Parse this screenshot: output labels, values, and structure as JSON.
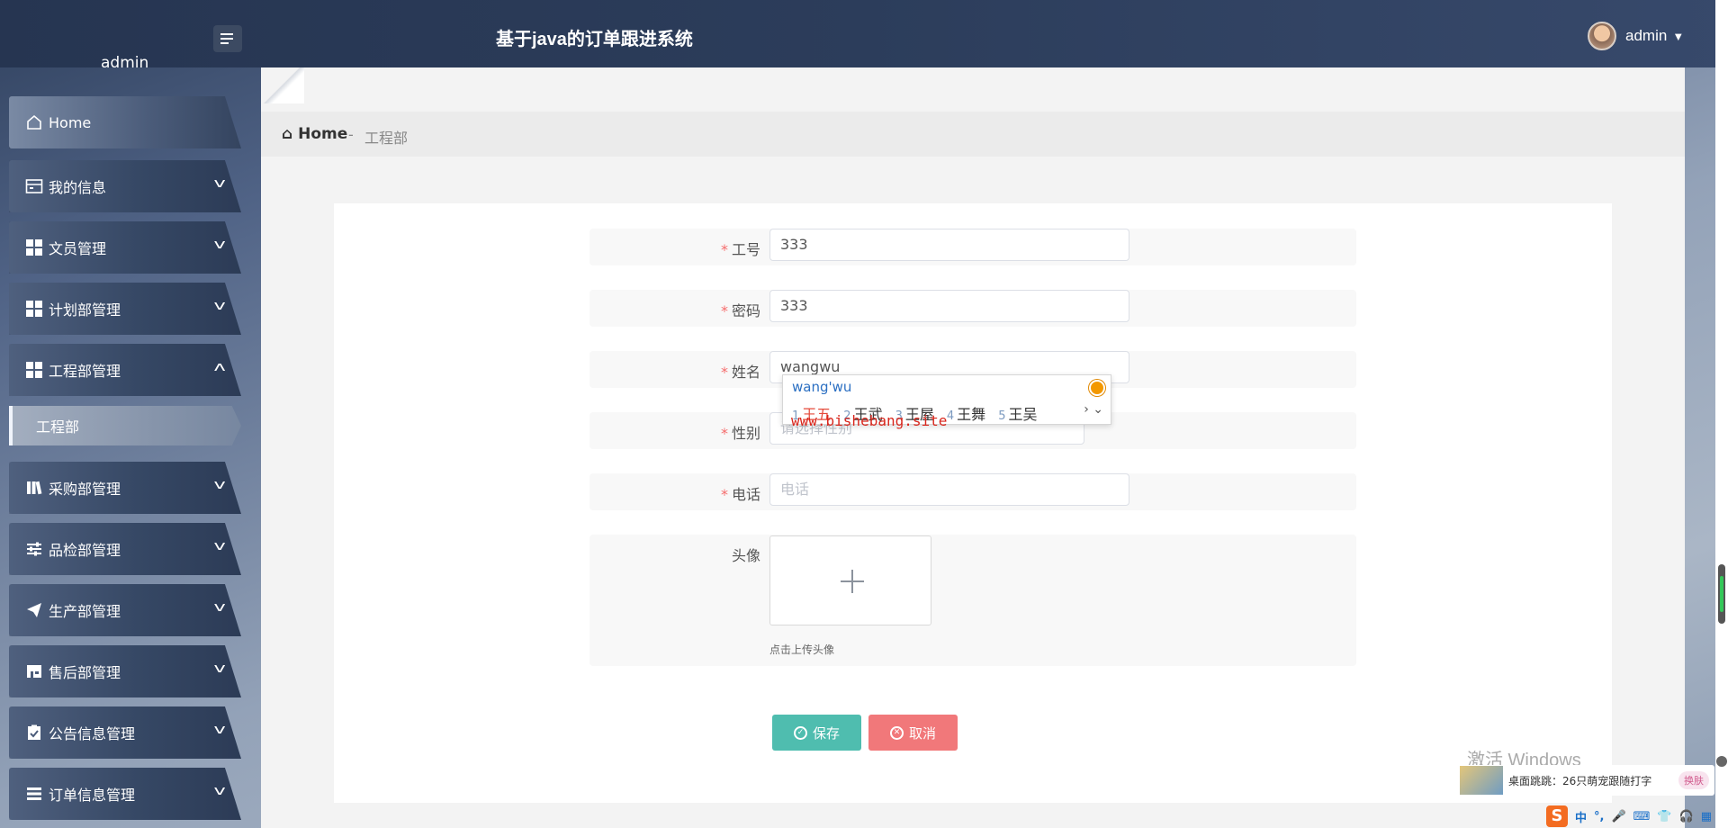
{
  "header": {
    "title": "基于java的订单跟进系统",
    "top_left_name": "admin",
    "user_name": "admin",
    "caret": "▼"
  },
  "sidebar": {
    "items": [
      {
        "label": "Home",
        "icon": "home-icon"
      },
      {
        "label": "我的信息",
        "icon": "card-icon"
      },
      {
        "label": "文员管理",
        "icon": "grid-icon"
      },
      {
        "label": "计划部管理",
        "icon": "grid-icon"
      },
      {
        "label": "工程部管理",
        "icon": "grid-icon",
        "expanded": true
      },
      {
        "label": "采购部管理",
        "icon": "book-icon"
      },
      {
        "label": "品检部管理",
        "icon": "sliders-icon"
      },
      {
        "label": "生产部管理",
        "icon": "paper-plane-icon"
      },
      {
        "label": "售后部管理",
        "icon": "store-icon"
      },
      {
        "label": "公告信息管理",
        "icon": "clipboard-check-icon"
      },
      {
        "label": "订单信息管理",
        "icon": "list-icon"
      }
    ],
    "sub_item": "工程部"
  },
  "breadcrumb": {
    "home": "Home",
    "separator": "-",
    "current": "工程部"
  },
  "form": {
    "fields": [
      {
        "label": "工号",
        "required": "*",
        "value": "333"
      },
      {
        "label": "密码",
        "required": "*",
        "value": "333"
      },
      {
        "label": "姓名",
        "required": "*",
        "value": "wangwu"
      },
      {
        "label": "性别",
        "required": "*",
        "placeholder": "请选择性别"
      },
      {
        "label": "电话",
        "required": "*",
        "placeholder": "电话"
      },
      {
        "label": "头像"
      }
    ],
    "upload_tip": "点击上传头像",
    "save_label": "保存",
    "cancel_label": "取消"
  },
  "ime": {
    "composition": "wang'wu",
    "candidates": [
      {
        "n": "1",
        "text": "王五"
      },
      {
        "n": "2",
        "text": "王武"
      },
      {
        "n": "3",
        "text": "王屋"
      },
      {
        "n": "4",
        "text": "王舞"
      },
      {
        "n": "5",
        "text": "王吴"
      }
    ],
    "more": "› ⌄"
  },
  "overlay": {
    "watermark_url": "www.bishebang.site",
    "windows_activate": "激活 Windows",
    "notify_text": "桌面跳跳：26只萌宠跟随打字",
    "notify_badge": "换肤"
  },
  "tray": {
    "logo": "S",
    "items": [
      "中",
      "°,",
      "🎤",
      "⌨",
      "👕",
      "🎧",
      "▦"
    ]
  },
  "colors": {
    "save": "#4fbdaf",
    "cancel": "#f1787a",
    "required": "#f56c6c",
    "header": "#2c3d5b"
  }
}
